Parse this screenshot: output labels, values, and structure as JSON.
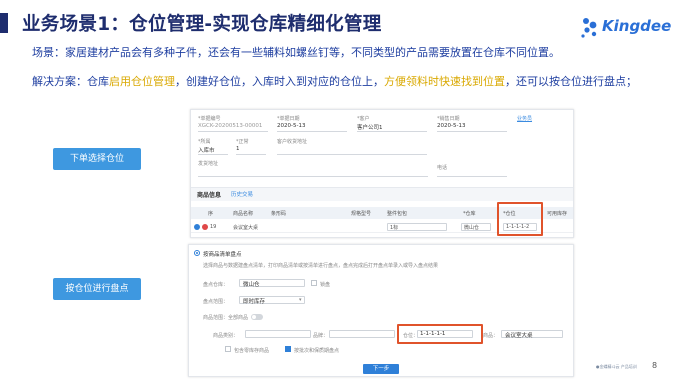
{
  "title": "业务场景1：仓位管理-实现仓库精细化管理",
  "logo": {
    "text": "Kingdee"
  },
  "scene": "场景：家居建材产品会有多种子件，还会有一些辅料如螺丝钉等，不同类型的产品需要放置在仓库不同位置。",
  "solution": {
    "p1": "解决方案：仓库",
    "h1": "启用仓位管理",
    "p2": "，创建好仓位，入库时入到对应的仓位上，",
    "h2": "方便领料时快速找到位置",
    "p3": "，还可以按仓位进行盘点；"
  },
  "buttons": {
    "order_select": "下单选择仓位",
    "count_by_location": "按仓位进行盘点"
  },
  "form1": {
    "bill_no_label": "*单据编号",
    "bill_no_value": "XGCK-20200513-00001",
    "bill_date_label": "*单据日期",
    "bill_date_value": "2020-5-13",
    "customer_label": "*客户",
    "customer_value": "客户公司1",
    "sale_date_label": "*销售日期",
    "sale_date_value": "2020-5-13",
    "business_link": "业务员",
    "sale_type_label": "*所属",
    "sale_type_value": "入库市",
    "status_label": "*正常",
    "status_value": "1",
    "address_label": "客户收货地址",
    "remark_label": "发货地址",
    "phone_label": "电话",
    "goods_section": "商品信息",
    "history_link": "历史交易",
    "grid": {
      "headers": [
        "",
        "序",
        "商品名称",
        "条形码",
        "规格型号",
        "整件包包",
        "*仓库",
        "*仓位",
        "可用库存"
      ],
      "row": {
        "seq": "19",
        "name": "会议室大桌",
        "unit": "1标",
        "warehouse": "微山仓",
        "location": "1-1-1-1-2"
      }
    }
  },
  "form2": {
    "mode_label": "按商品清单盘点",
    "desc": "选择商品与数据建盘点清单，打印商品清单或按清单进行盘点，盘点完成后打开盘点单录入或导入盘点结果",
    "warehouse_label": "盘点仓库：",
    "warehouse_value": "微山仓",
    "lock_label": "锁盘",
    "locked_text": "已锁",
    "inventory_label": "盘点范围：",
    "inventory_value": "即时库存",
    "scope_label": "商品范围：全部商品",
    "category_label": "商品类别：",
    "brand_label": "品牌：",
    "location_label": "仓位：",
    "location_value": "1-1-1-1-1",
    "product_label": "商品：",
    "product_value": "会议室大桌",
    "zero_stock": "包含零库存商品",
    "sort_label": "按批次和保质期盘点",
    "next_button": "下一步"
  },
  "footer": {
    "note": "●金蝶精斗云 产品培训",
    "page": "8"
  },
  "colors": {
    "title": "#1e2d6e",
    "body_text": "#1e3ea0",
    "highlight": "#d9a800",
    "button_blue": "#3e98e0",
    "red_box": "#e0532b"
  }
}
